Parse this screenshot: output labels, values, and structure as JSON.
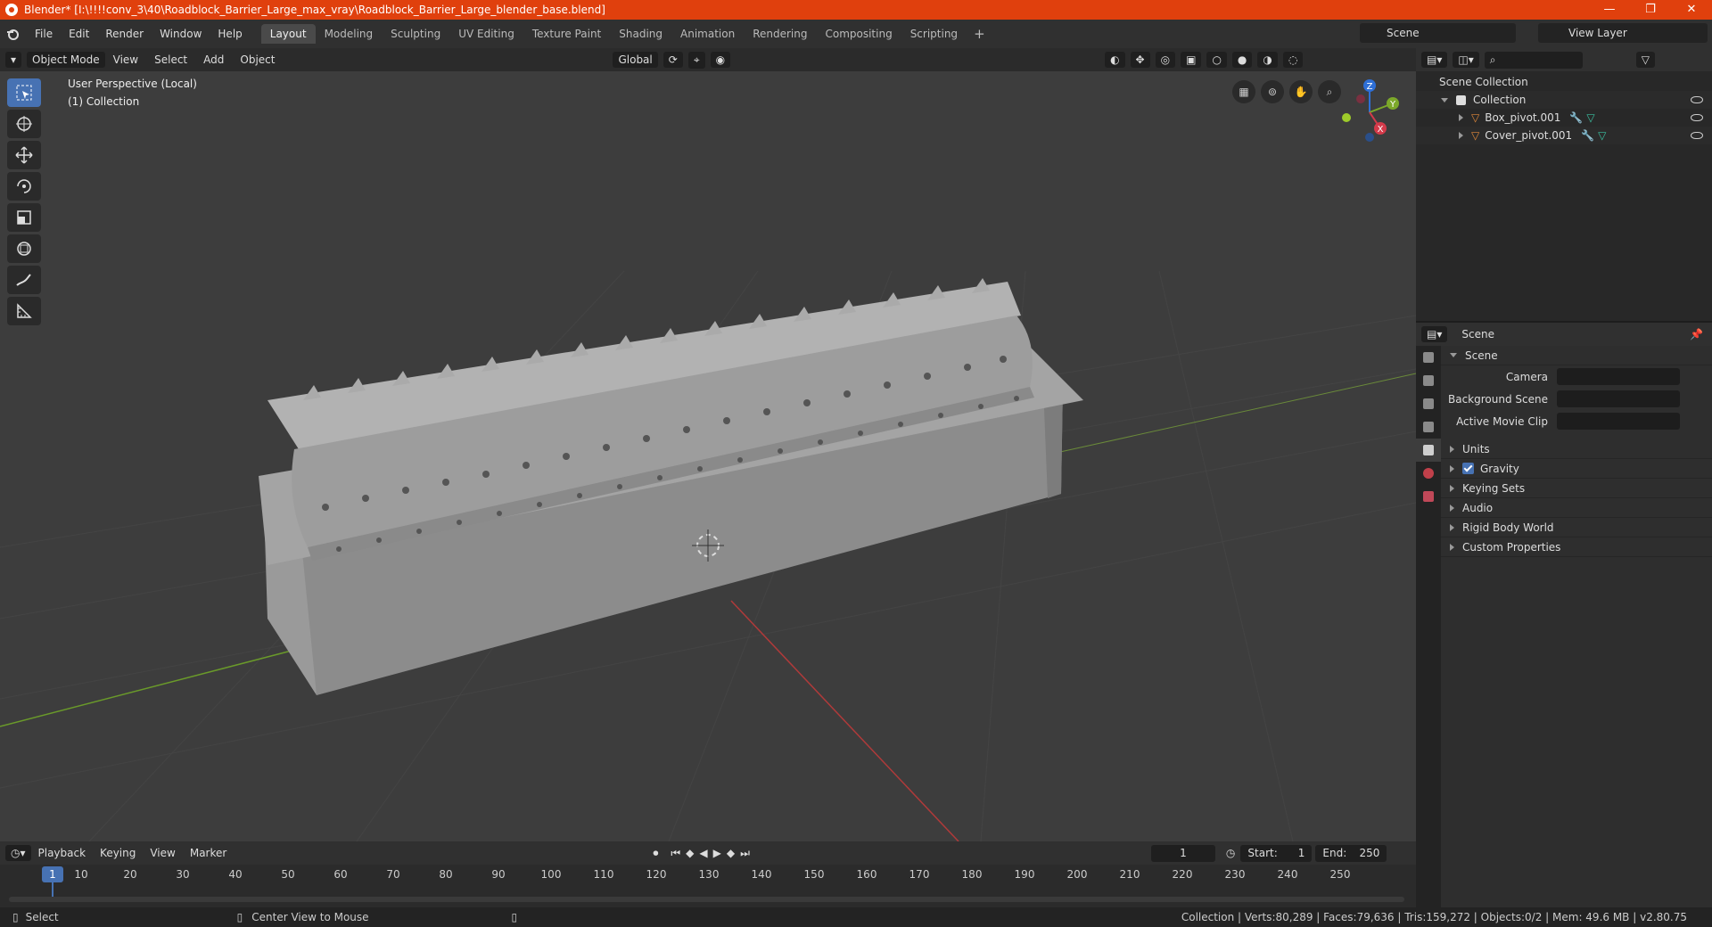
{
  "titlebar": {
    "title": "Blender* [I:\\!!!!conv_3\\40\\Roadblock_Barrier_Large_max_vray\\Roadblock_Barrier_Large_blender_base.blend]",
    "minimize": "—",
    "maximize": "❐",
    "close": "✕"
  },
  "menu": [
    "File",
    "Edit",
    "Render",
    "Window",
    "Help"
  ],
  "workspaces": [
    "Layout",
    "Modeling",
    "Sculpting",
    "UV Editing",
    "Texture Paint",
    "Shading",
    "Animation",
    "Rendering",
    "Compositing",
    "Scripting"
  ],
  "workspace_add": "+",
  "scene": "Scene",
  "view_layer": "View Layer",
  "viewport": {
    "mode": "Object Mode",
    "menus": [
      "View",
      "Select",
      "Add",
      "Object"
    ],
    "orientation": "Global",
    "info_line1": "User Perspective (Local)",
    "info_line2": "(1) Collection"
  },
  "gizmo": {
    "z": "Z",
    "y": "Y",
    "x": "X"
  },
  "outliner": {
    "scene_collection": "Scene Collection",
    "collection": "Collection",
    "objects": [
      "Box_pivot.001",
      "Cover_pivot.001"
    ]
  },
  "properties": {
    "header": "Scene",
    "panel_title": "Scene",
    "fields": [
      "Camera",
      "Background Scene",
      "Active Movie Clip"
    ],
    "panels": [
      "Units",
      "Gravity",
      "Keying Sets",
      "Audio",
      "Rigid Body World",
      "Custom Properties"
    ]
  },
  "timeline": {
    "menus": [
      "Playback",
      "Keying",
      "View",
      "Marker"
    ],
    "current_frame": "1",
    "start_label": "Start:",
    "start": "1",
    "end_label": "End:",
    "end": "250",
    "ticks": [
      "1",
      "10",
      "20",
      "30",
      "40",
      "50",
      "60",
      "70",
      "80",
      "90",
      "100",
      "110",
      "120",
      "130",
      "140",
      "150",
      "160",
      "170",
      "180",
      "190",
      "200",
      "210",
      "220",
      "230",
      "240",
      "250"
    ]
  },
  "statusbar": {
    "left": "Select",
    "middle": "Center View to Mouse",
    "right": "Collection | Verts:80,289 | Faces:79,636 | Tris:159,272 | Objects:0/2 | Mem: 49.6 MB | v2.80.75"
  }
}
